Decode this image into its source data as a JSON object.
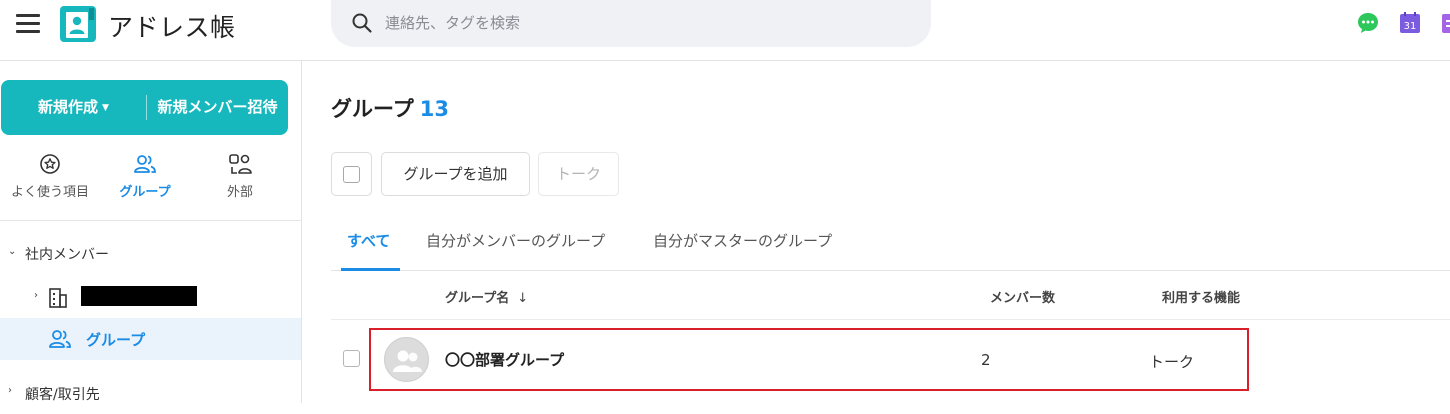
{
  "header": {
    "app_title": "アドレス帳",
    "search_placeholder": "連絡先、タグを検索",
    "icons": [
      "hamburger-menu-icon",
      "address-book-logo-icon",
      "search-icon",
      "chat-icon",
      "calendar-icon",
      "app-icon"
    ],
    "calendar_day": "31",
    "colors": {
      "brand": "#17b8bd",
      "chat": "#2ec75b",
      "calendar": "#7b5ce0"
    }
  },
  "sidebar": {
    "create_button": {
      "new_label": "新規作成",
      "invite_label": "新規メンバー招待"
    },
    "nav_tabs": [
      {
        "label": "よく使う項目",
        "icon": "star-circle-icon",
        "active": false
      },
      {
        "label": "グループ",
        "icon": "group-icon",
        "active": true
      },
      {
        "label": "外部",
        "icon": "external-icon",
        "active": false
      }
    ],
    "tree": {
      "internal_members": "社内メンバー",
      "group": "グループ",
      "customers": "顧客/取引先"
    }
  },
  "main": {
    "title": "グループ",
    "count": "13",
    "toolbar": {
      "add_group": "グループを追加",
      "talk": "トーク"
    },
    "filter_tabs": [
      "すべて",
      "自分がメンバーのグループ",
      "自分がマスターのグループ"
    ],
    "columns": {
      "name": "グループ名",
      "sort_indicator": "↓",
      "members": "メンバー数",
      "features": "利用する機能"
    },
    "rows": [
      {
        "name": "〇〇部署グループ",
        "members": "2",
        "features": "トーク"
      }
    ],
    "accent_color": "#1a8ce6",
    "highlight_color": "#d9202a"
  }
}
